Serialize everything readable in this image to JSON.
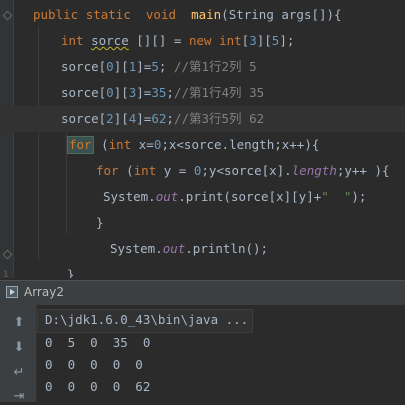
{
  "editor": {
    "lines": [
      [
        [
          "kw",
          "public "
        ],
        [
          "kw",
          "static  "
        ],
        [
          "kw",
          "void  "
        ],
        [
          "fn",
          "main"
        ],
        [
          "t",
          "(String args[]){"
        ]
      ],
      [
        [
          "kw",
          "int "
        ],
        [
          "warn",
          "sorce"
        ],
        [
          "t",
          " [][] = "
        ],
        [
          "kw",
          "new "
        ],
        [
          "kw",
          "int"
        ],
        [
          "t",
          "["
        ],
        [
          "num",
          "3"
        ],
        [
          "t",
          "]["
        ],
        [
          "num",
          "5"
        ],
        [
          "t",
          "];"
        ]
      ],
      [
        [
          "t",
          "sorce["
        ],
        [
          "num",
          "0"
        ],
        [
          "t",
          "]["
        ],
        [
          "num",
          "1"
        ],
        [
          "t",
          "]="
        ],
        [
          "num",
          "5"
        ],
        [
          "t",
          "; "
        ],
        [
          "cmt",
          "//第1行2列 5"
        ]
      ],
      [
        [
          "t",
          "sorce["
        ],
        [
          "num",
          "0"
        ],
        [
          "t",
          "]["
        ],
        [
          "num",
          "3"
        ],
        [
          "t",
          "]="
        ],
        [
          "num",
          "35"
        ],
        [
          "t",
          ";"
        ],
        [
          "cmt",
          "//第1行4列 35"
        ]
      ],
      [
        [
          "t",
          "sorce["
        ],
        [
          "num",
          "2"
        ],
        [
          "t",
          "]["
        ],
        [
          "num",
          "4"
        ],
        [
          "t",
          "]="
        ],
        [
          "num",
          "62"
        ],
        [
          "t",
          ";"
        ],
        [
          "cmt",
          "//第3行5列 62"
        ]
      ],
      [
        [
          "forkw",
          "for"
        ],
        [
          "t",
          " ("
        ],
        [
          "kw",
          "int "
        ],
        [
          "t",
          "x="
        ],
        [
          "num",
          "0"
        ],
        [
          "t",
          ";x<sorce.length;x++){"
        ]
      ],
      [
        [
          "kw",
          "for "
        ],
        [
          "t",
          "("
        ],
        [
          "kw",
          "int "
        ],
        [
          "t",
          "y = "
        ],
        [
          "num",
          "0"
        ],
        [
          "t",
          ";y<sorce[x]."
        ],
        [
          "field",
          "length"
        ],
        [
          "t",
          ";y++ ){"
        ]
      ],
      [
        [
          "t",
          "System."
        ],
        [
          "field",
          "out"
        ],
        [
          "t",
          ".print(sorce[x][y]+"
        ],
        [
          "str",
          "\"  \""
        ],
        [
          "t",
          ");"
        ]
      ],
      [
        [
          "t",
          "}"
        ]
      ],
      [
        [
          "t",
          "System."
        ],
        [
          "field",
          "out"
        ],
        [
          "t",
          ".println();"
        ]
      ],
      [
        [
          "t",
          "}"
        ]
      ],
      [
        [
          "t",
          "}"
        ]
      ]
    ],
    "gutter_label": "1"
  },
  "run_panel": {
    "tab_label": "Array2",
    "command": "D:\\jdk1.6.0_43\\bin\\java ...",
    "output": [
      "0  5  0  35  0",
      "0  0  0  0  0",
      "0  0  0  0  62"
    ]
  },
  "toolbar": {
    "icons": [
      "rerun-up-icon",
      "rerun-down-icon",
      "soft-wrap-icon",
      "scroll-to-end-icon"
    ],
    "glyphs": [
      "⬆",
      "⬇",
      "↵",
      "⇥"
    ]
  },
  "colors": {
    "background": "#2b2b2b",
    "keyword": "#cc7832",
    "method": "#ffc66d",
    "number": "#6897bb",
    "comment": "#808080",
    "string": "#6a8759",
    "field": "#9876aa",
    "text": "#a9b7c6"
  }
}
